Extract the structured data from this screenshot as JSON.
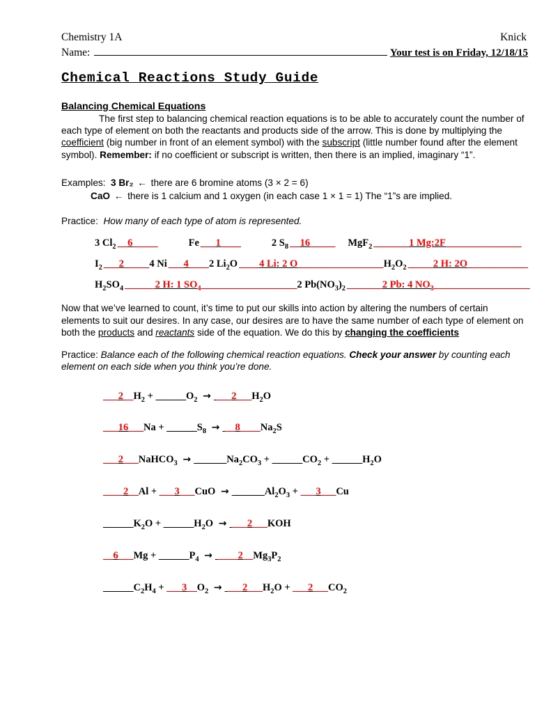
{
  "header": {
    "course": "Chemistry 1A",
    "teacher": "Knick",
    "name_label": "Name:",
    "test_note": "Your test is on Friday, 12/18/15",
    "title": "Chemical Reactions Study Guide"
  },
  "section1": {
    "heading": "Balancing Chemical Equations",
    "para_part1": "The first step to balancing chemical reaction equations is to be able to accurately count the number of each type of element on both the reactants and products side of the arrow.  This is done by multiplying the ",
    "para_coefficient": "coefficient",
    "para_part2": " (big number in front of an element symbol) with the ",
    "para_subscript": "subscript",
    "para_part3": " (little number found after the element symbol).  ",
    "para_remember": "Remember:",
    "para_part4": "  if no coefficient or subscript is written, then there is an implied, imaginary “1”."
  },
  "examples": {
    "label": "Examples:",
    "arrow": "←",
    "item1_formula": "3 Br₂",
    "item1_text": "there are 6 bromine atoms (3 × 2 = 6)",
    "item2_formula": "CaO",
    "item2_text": "there is 1 calcium and 1 oxygen (in each case 1 × 1 = 1)  The “1”s are implied."
  },
  "practice1": {
    "label": "Practice:",
    "instruction": "How many of each type of atom is represented.",
    "rows": [
      [
        {
          "formula": "3 Cl₂",
          "pre": "__",
          "answer": "6",
          "post": "_____",
          "gap": "spacer-md"
        },
        {
          "formula": "Fe",
          "pre": "___",
          "answer": "1",
          "post": "____",
          "gap": "spacer-md"
        },
        {
          "formula": "2 S₈",
          "pre": "__",
          "answer": "16",
          "post": "_____",
          "gap": "spacer-lg"
        },
        {
          "formula": "MgF₂",
          "pre": "_______",
          "answer": "1 Mg:2F",
          "post": "_______________",
          "gap": ""
        }
      ],
      [
        {
          "formula": "I₂",
          "pre": "___",
          "answer": "2",
          "post": "_____",
          "gap": "spacer-md"
        },
        {
          "formula": "4 Ni",
          "pre": "___",
          "answer": "4",
          "post": "____",
          "gap": "spacer-md"
        },
        {
          "formula": "2 Li₂O",
          "pre": "____",
          "answer": "4 Li: 2 O",
          "post": "_________________",
          "gap": "spacer-lg"
        },
        {
          "formula": "H₂O₂",
          "pre": "_____",
          "answer": "2 H: 2O",
          "post": "____________",
          "gap": ""
        }
      ],
      [
        {
          "formula": "H₂SO₄",
          "pre": "______",
          "answer": "2 H: 1 SO₄",
          "post": "___________________",
          "gap": "spacer-lg"
        },
        {
          "formula": "2 Pb(NO₃)₂",
          "pre": "_______",
          "answer": "2 Pb: 4 NO₃",
          "post": "___________________",
          "gap": ""
        }
      ]
    ]
  },
  "section2": {
    "para_part1": "Now that we’ve learned to count, it’s time to put our skills into action by altering the numbers of certain elements to suit our desires.  In any case, our desires are to have the same number of each type of element on both the ",
    "para_products": "products",
    "para_part2": " and ",
    "para_reactants": "reactants",
    "para_part3": " side of the equation.  We do this by ",
    "para_changing": "changing the coefficients"
  },
  "practice2": {
    "label": "Practice:",
    "instruction_part1": "Balance each of the following chemical reaction equations.  ",
    "instruction_check": "Check your answer",
    "instruction_part2": " by counting each element on each side when you think you’re done.",
    "arrow": "→",
    "equations": [
      {
        "parts": [
          {
            "pre": "___",
            "answer": "2",
            "post": "__"
          },
          {
            "text": "H₂ + "
          },
          {
            "pre": "______",
            "answer": "",
            "post": ""
          },
          {
            "text": "O₂ "
          },
          {
            "arrow": true
          },
          {
            "pre": " ___",
            "answer": "2",
            "post": "___"
          },
          {
            "text": "H₂O"
          }
        ]
      },
      {
        "parts": [
          {
            "pre": "___",
            "answer": "16",
            "post": "___"
          },
          {
            "text": "Na + "
          },
          {
            "pre": "______",
            "answer": "",
            "post": ""
          },
          {
            "text": "S₈ "
          },
          {
            "arrow": true
          },
          {
            "pre": " __",
            "answer": "8",
            "post": "____"
          },
          {
            "text": "Na₂S"
          }
        ]
      },
      {
        "parts": [
          {
            "pre": "___",
            "answer": "2",
            "post": "___"
          },
          {
            "text": "NaHCO₃ "
          },
          {
            "arrow": true
          },
          {
            "pre": " ______",
            "answer": "",
            "post": ""
          },
          {
            "text": "Na₂CO₃ + "
          },
          {
            "pre": "______",
            "answer": "",
            "post": ""
          },
          {
            "text": "CO₂ + "
          },
          {
            "pre": "______",
            "answer": "",
            "post": ""
          },
          {
            "text": "H₂O"
          }
        ]
      },
      {
        "parts": [
          {
            "pre": "____",
            "answer": "2",
            "post": "__"
          },
          {
            "text": "Al + "
          },
          {
            "pre": "___",
            "answer": "3",
            "post": "___"
          },
          {
            "text": "CuO "
          },
          {
            "arrow": true
          },
          {
            "pre": " ______",
            "answer": "",
            "post": ""
          },
          {
            "text": "Al₂O₃ + "
          },
          {
            "pre": "___",
            "answer": "3",
            "post": "___"
          },
          {
            "text": "Cu"
          }
        ]
      },
      {
        "parts": [
          {
            "pre": "______",
            "answer": "",
            "post": ""
          },
          {
            "text": "K₂O + "
          },
          {
            "pre": "______",
            "answer": "",
            "post": ""
          },
          {
            "text": "H₂O "
          },
          {
            "arrow": true
          },
          {
            "pre": " ___",
            "answer": "2",
            "post": "___"
          },
          {
            "text": "KOH"
          }
        ]
      },
      {
        "parts": [
          {
            "pre": "__",
            "answer": "6",
            "post": "___"
          },
          {
            "text": "Mg + "
          },
          {
            "pre": "______",
            "answer": "",
            "post": ""
          },
          {
            "text": "P₄ "
          },
          {
            "arrow": true
          },
          {
            "pre": " ____",
            "answer": "2",
            "post": "__"
          },
          {
            "text": "Mg₃P₂"
          }
        ]
      },
      {
        "parts": [
          {
            "pre": "______",
            "answer": "",
            "post": ""
          },
          {
            "text": "C₂H₄ + "
          },
          {
            "pre": "___",
            "answer": "3",
            "post": "__"
          },
          {
            "text": "O₂ "
          },
          {
            "arrow": true
          },
          {
            "pre": " ___",
            "answer": "2",
            "post": "___"
          },
          {
            "text": "H₂O + "
          },
          {
            "pre": "___",
            "answer": "2",
            "post": "___"
          },
          {
            "text": "CO₂"
          }
        ]
      }
    ]
  },
  "colors": {
    "ink_red": "#ff0000",
    "text_black": "#000000",
    "paper": "#ffffff"
  }
}
